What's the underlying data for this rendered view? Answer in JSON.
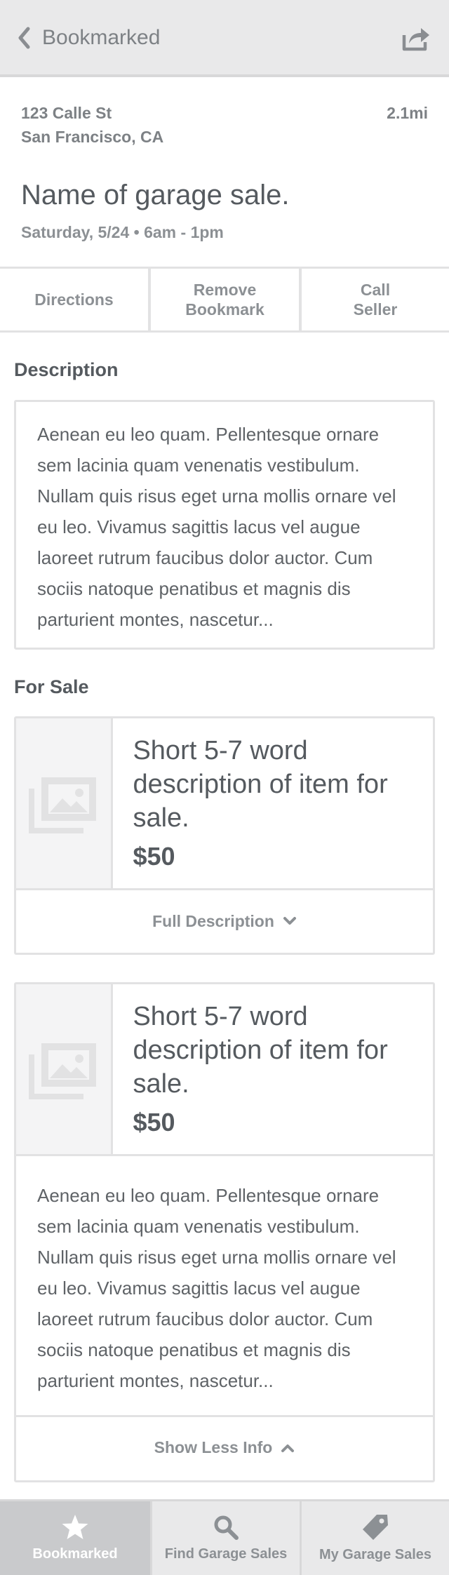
{
  "header": {
    "back_label": "Bookmarked",
    "icons": {
      "back": "chevron-left-icon",
      "share": "share-icon"
    }
  },
  "sale": {
    "address_line1": "123 Calle St",
    "address_line2": "San Francisco, CA",
    "distance": "2.1mi",
    "name": "Name of garage sale.",
    "date": "Saturday, 5/24 • 6am - 1pm"
  },
  "actions": [
    {
      "label": "Directions"
    },
    {
      "label": "Remove Bookmark"
    },
    {
      "label": "Call Seller"
    }
  ],
  "description": {
    "title": "Description",
    "text": "Aenean eu leo quam. Pellentesque ornare sem lacinia quam venenatis vestibulum. Nullam quis risus eget urna mollis ornare vel eu leo. Vivamus sagittis lacus vel augue laoreet rutrum faucibus dolor auctor. Cum sociis natoque penatibus et magnis dis parturient montes, nascetur..."
  },
  "for_sale": {
    "title": "For Sale",
    "items": [
      {
        "title": "Short 5-7 word description of item for sale.",
        "price": "$50",
        "toggle_label": "Full Description",
        "expanded": false,
        "icon": "image-placeholder-icon"
      },
      {
        "title": "Short 5-7 word description of item for sale.",
        "price": "$50",
        "description": "Aenean eu leo quam. Pellentesque ornare sem lacinia quam venenatis vestibulum. Nullam quis risus eget urna mollis ornare vel eu leo. Vivamus sagittis lacus vel augue laoreet rutrum faucibus dolor auctor. Cum sociis natoque penatibus et magnis dis parturient montes, nascetur...",
        "toggle_label": "Show Less Info",
        "expanded": true,
        "icon": "image-placeholder-icon"
      }
    ]
  },
  "tabbar": {
    "tabs": [
      {
        "label": "Bookmarked",
        "icon": "star-icon",
        "active": true
      },
      {
        "label": "Find Garage Sales",
        "icon": "search-icon",
        "active": false
      },
      {
        "label": "My Garage Sales",
        "icon": "tag-icon",
        "active": false
      }
    ]
  }
}
